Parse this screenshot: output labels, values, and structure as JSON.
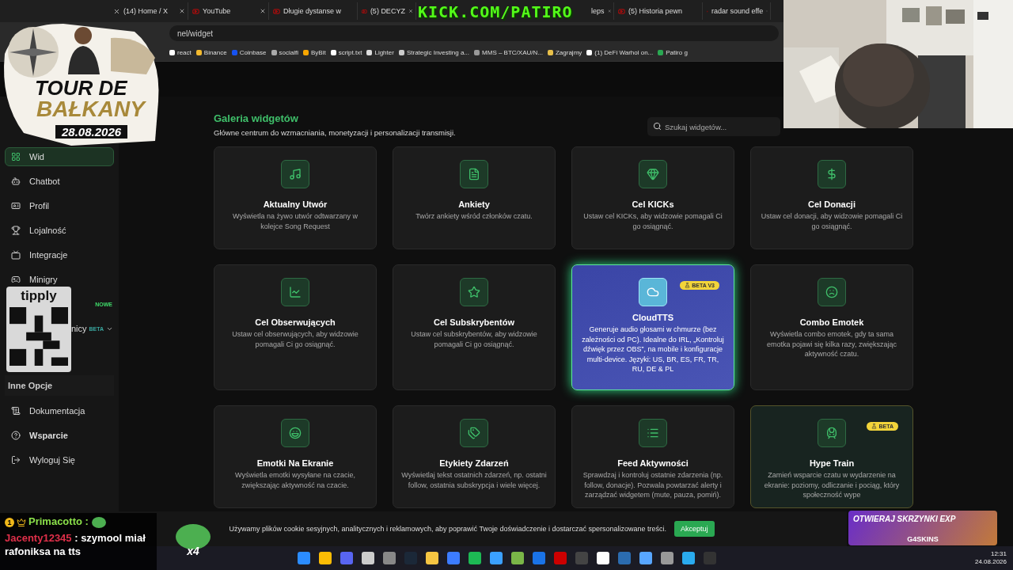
{
  "browser": {
    "tabs": [
      {
        "label": "(14) Home / X"
      },
      {
        "label": "YouTube"
      },
      {
        "label": "Długie dystanse w"
      },
      {
        "label": "(5) DECYZ"
      },
      {
        "label": "leps"
      },
      {
        "label": "(5) Historia pewn"
      },
      {
        "label": "radar sound effe"
      }
    ],
    "address": "nel/widget",
    "bookmarks": [
      "react",
      "Binance",
      "Coinbase",
      "socialfi",
      "ByBit",
      "script.txt",
      "Lighter",
      "Strategic Investing a...",
      "MMS – BTC/XAU/N...",
      "Zagrajmy",
      "(1) DeFi Warhol on...",
      "Patiro g"
    ]
  },
  "sidebar": {
    "items": [
      {
        "label": "Wid",
        "selected": true
      },
      {
        "label": "Chatbot",
        "selected": false
      },
      {
        "label": "Profil",
        "selected": false
      },
      {
        "label": "Lojalność",
        "selected": false
      },
      {
        "label": "Integracje",
        "selected": false
      },
      {
        "label": "Minigry",
        "selected": false
      },
      {
        "badge": "NOWE",
        "selected": false
      },
      {
        "label": "nicy",
        "badge": "BETA",
        "has_submenu": true,
        "selected": false
      }
    ],
    "section": "Inne Opcje",
    "footer_items": [
      {
        "label": "Dokumentacja",
        "emphasized": false
      },
      {
        "label": "Wsparcie",
        "emphasized": true
      },
      {
        "label": "Wyloguj Się",
        "emphasized": false
      }
    ]
  },
  "gallery": {
    "title": "Galeria widgetów",
    "subtitle": "Główne centrum do wzmacniania, monetyzacji i personalizacji transmisji.",
    "search": {
      "placeholder": "Szukaj widgetów..."
    },
    "cards": [
      {
        "title": "Aktualny Utwór",
        "description": "Wyświetla na żywo utwór odtwarzany w kolejce Song Request",
        "highlighted": false
      },
      {
        "title": "Ankiety",
        "description": "Twórz ankiety wśród członków czatu.",
        "highlighted": false
      },
      {
        "title": "Cel KICKs",
        "description": "Ustaw cel KICKs, aby widzowie pomagali Ci go osiągnąć.",
        "highlighted": false
      },
      {
        "title": "Cel Donacji",
        "description": "Ustaw cel donacji, aby widzowie pomagali Ci go osiągnąć.",
        "highlighted": false
      },
      {
        "title": "Cel Obserwujących",
        "description": "Ustaw cel obserwujących, aby widzowie pomagali Ci go osiągnąć.",
        "highlighted": false
      },
      {
        "title": "Cel Subskrybentów",
        "description": "Ustaw cel subskrybentów, aby widzowie pomagali Ci go osiągnąć.",
        "highlighted": false
      },
      {
        "title": "CloudTTS",
        "description": "Generuje audio głosami w chmurze (bez zależności od PC). Idealne do IRL, „Kontroluj dźwięk przez OBS”, na mobile i konfiguracje multi-device. Języki: US, BR, ES, FR, TR, RU, DE & PL",
        "badge": "BETA V3",
        "highlighted": true
      },
      {
        "title": "Combo Emotek",
        "description": "Wyświetla combo emotek, gdy ta sama emotka pojawi się kilka razy, zwiększając aktywność czatu.",
        "highlighted": false
      },
      {
        "title": "Emotki Na Ekranie",
        "description": "Wyświetla emotki wysyłane na czacie, zwiększając aktywność na czacie.",
        "highlighted": false
      },
      {
        "title": "Etykiety Zdarzeń",
        "description": "Wyświetlaj tekst ostatnich zdarzeń, np. ostatni follow, ostatnia subskrypcja i wiele więcej.",
        "highlighted": false
      },
      {
        "title": "Feed Aktywności",
        "description": "Sprawdzaj i kontroluj ostatnie zdarzenia (np. follow, donacje). Pozwala powtarzać alerty i zarządzać widgetem (mute, pauza, pomiń).",
        "highlighted": false
      },
      {
        "title": "Hype Train",
        "description": "Zamień wsparcie czatu w wydarzenie na ekranie: poziomy, odliczanie i pociąg, który społeczność wype",
        "badge": "BETA",
        "highlighted": false
      }
    ]
  },
  "cookie_banner": {
    "text": "Używamy plików cookie sesyjnych, analitycznych i reklamowych, aby poprawić Twoje doświadczenie i dostarczać spersonalizowane treści.",
    "button": "Akceptuj"
  },
  "taskbar": {
    "time": "12:31",
    "date": "24.08.2026"
  },
  "stream_overlay": {
    "channel": "KICK.COM/PATIRO",
    "sticker": {
      "line1": "TOUR DE",
      "line2": "BAŁKANY",
      "date": "28.08.2026"
    },
    "tipply": {
      "logo": "tipply"
    },
    "chat": [
      {
        "badge": "1",
        "user": "Primacotto :",
        "color": "#8be04a",
        "emote": true
      },
      {
        "user": "Jacenty12345",
        "color": "#e0304a",
        "text": ": szymool miał rafoniksa na tts"
      }
    ],
    "emote_combo": "x4",
    "promo": {
      "headline": "OTWIERAJ SKRZYNKI EXP",
      "brand": "G4SKINS"
    }
  }
}
